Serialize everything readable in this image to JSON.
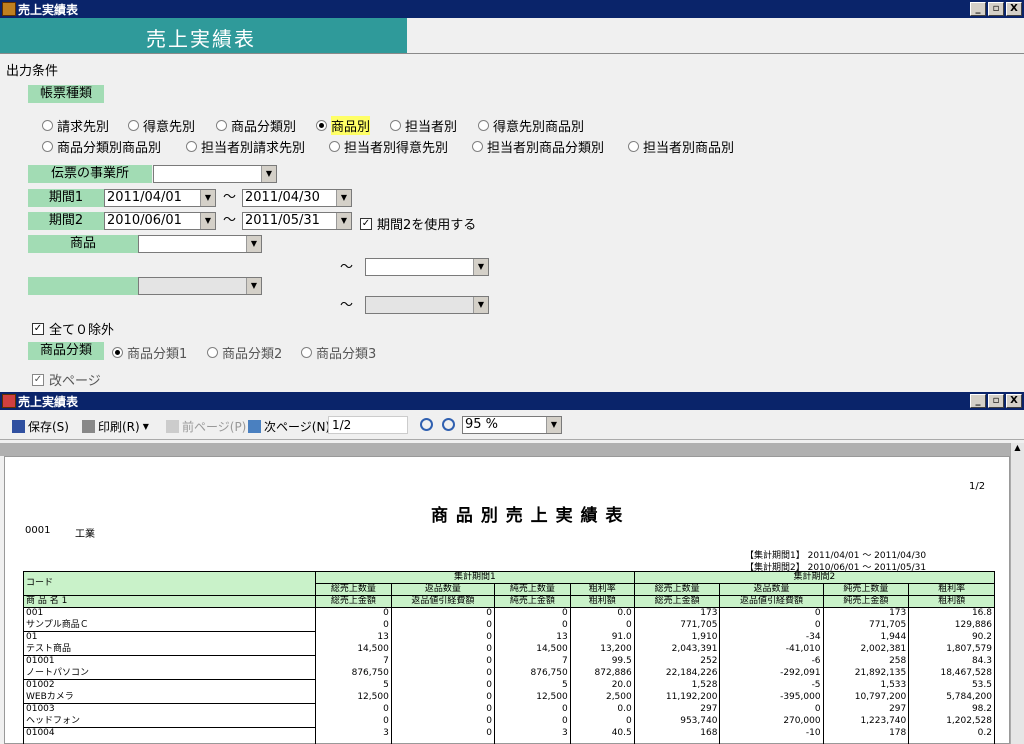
{
  "window": {
    "title": "売上実績表",
    "btn_min": "_",
    "btn_max": "▫",
    "btn_close": "X"
  },
  "banner": "売上実績表",
  "section_title": "出力条件",
  "report_type": {
    "label": "帳票種類",
    "options": [
      "請求先別",
      "得意先別",
      "商品分類別",
      "商品別",
      "担当者別",
      "得意先別商品別",
      "商品分類別商品別",
      "担当者別請求先別",
      "担当者別得意先別",
      "担当者別商品分類別",
      "担当者別商品別"
    ],
    "selected": "商品別"
  },
  "office": {
    "label": "伝票の事業所",
    "value": ""
  },
  "period1": {
    "label": "期間1",
    "from": "2011/04/01",
    "tilde": "〜",
    "to": "2011/04/30"
  },
  "period2": {
    "label": "期間2",
    "from": "2010/06/01",
    "tilde": "〜",
    "to": "2011/05/31",
    "use_label": "期間2を使用する",
    "use_checked": true
  },
  "product": {
    "label": "商品",
    "from": "",
    "tilde": "〜",
    "to": ""
  },
  "blank_filter": {
    "tilde": "〜"
  },
  "exclude_zero": {
    "label": "全て０除外",
    "checked": true
  },
  "product_class": {
    "label": "商品分類",
    "options": [
      "商品分類1",
      "商品分類2",
      "商品分類3"
    ],
    "selected": "商品分類1"
  },
  "page_break": {
    "label": "改ページ",
    "checked": true
  },
  "viewer": {
    "title": "売上実績表",
    "save": "保存(S)",
    "print": "印刷(R)",
    "prev": "前ページ(P)",
    "next": "次ページ(N)",
    "page": "1/2",
    "zoom": "95 %"
  },
  "report": {
    "page_no": "1/2",
    "title": "商 品 別 売 上 実 績 表",
    "company_code": "0001",
    "company_name": "工業",
    "period1_label": "【集計期間1】 2011/04/01 〜 2011/04/30",
    "period2_label": "【集計期間2】 2010/06/01 〜 2011/05/31",
    "header": {
      "code": "コード",
      "name": "商 品 名 1",
      "p1": "集計期間1",
      "p2": "集計期間2",
      "cols_top": [
        "総売上数量",
        "返品数量",
        "純売上数量",
        "粗利率"
      ],
      "cols_bottom": [
        "総売上金額",
        "返品値引経費額",
        "純売上金額",
        "粗利額"
      ]
    },
    "rows": [
      {
        "code": "001",
        "name": "サンプル商品Ｃ",
        "p1_top": [
          "0",
          "0",
          "0",
          "0.0"
        ],
        "p1_bot": [
          "0",
          "0",
          "0",
          "0"
        ],
        "p2_top": [
          "173",
          "0",
          "173",
          "16.8"
        ],
        "p2_bot": [
          "771,705",
          "0",
          "771,705",
          "129,886"
        ]
      },
      {
        "code": "01",
        "name": "テスト商品",
        "p1_top": [
          "13",
          "0",
          "13",
          "91.0"
        ],
        "p1_bot": [
          "14,500",
          "0",
          "14,500",
          "13,200"
        ],
        "p2_top": [
          "1,910",
          "-34",
          "1,944",
          "90.2"
        ],
        "p2_bot": [
          "2,043,391",
          "-41,010",
          "2,002,381",
          "1,807,579"
        ]
      },
      {
        "code": "01001",
        "name": "ノートパソコン",
        "p1_top": [
          "7",
          "0",
          "7",
          "99.5"
        ],
        "p1_bot": [
          "876,750",
          "0",
          "876,750",
          "872,886"
        ],
        "p2_top": [
          "252",
          "-6",
          "258",
          "84.3"
        ],
        "p2_bot": [
          "22,184,226",
          "-292,091",
          "21,892,135",
          "18,467,528"
        ]
      },
      {
        "code": "01002",
        "name": "WEBカメラ",
        "p1_top": [
          "5",
          "0",
          "5",
          "20.0"
        ],
        "p1_bot": [
          "12,500",
          "0",
          "12,500",
          "2,500"
        ],
        "p2_top": [
          "1,528",
          "-5",
          "1,533",
          "53.5"
        ],
        "p2_bot": [
          "11,192,200",
          "-395,000",
          "10,797,200",
          "5,784,200"
        ]
      },
      {
        "code": "01003",
        "name": "ヘッドフォン",
        "p1_top": [
          "0",
          "0",
          "0",
          "0.0"
        ],
        "p1_bot": [
          "0",
          "0",
          "0",
          "0"
        ],
        "p2_top": [
          "297",
          "0",
          "297",
          "98.2"
        ],
        "p2_bot": [
          "953,740",
          "270,000",
          "1,223,740",
          "1,202,528"
        ]
      },
      {
        "code": "01004",
        "name": "",
        "p1_top": [
          "3",
          "0",
          "3",
          "40.5"
        ],
        "p1_bot": [
          "",
          "",
          "",
          ""
        ],
        "p2_top": [
          "168",
          "-10",
          "178",
          "0.2"
        ],
        "p2_bot": [
          "",
          "",
          "",
          ""
        ]
      }
    ]
  }
}
